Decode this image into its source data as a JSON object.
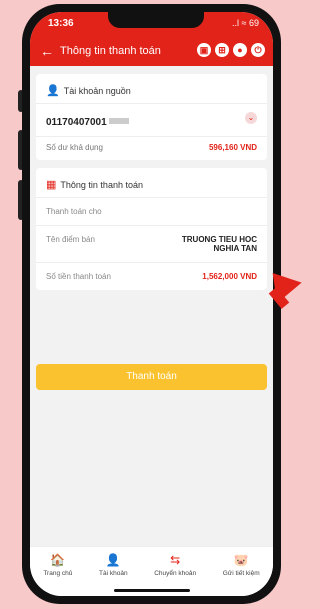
{
  "status": {
    "time": "13:36",
    "signal": "..l ≈ 69"
  },
  "header": {
    "back_icon": "←",
    "title": "Thông tin thanh toán",
    "icons": [
      "qr-icon",
      "grid-icon",
      "account-icon",
      "power-icon"
    ]
  },
  "source": {
    "section_title": "Tài khoản nguồn",
    "account_number": "01170407001",
    "balance_label": "Số dư khả dụng",
    "balance_value": "596,160 VND"
  },
  "payment": {
    "section_title": "Thông tin thanh toán",
    "pay_for_label": "Thanh toán cho",
    "merchant_label": "Tên điểm bán",
    "merchant_value": "TRUONG TIEU HOC\nNGHIA TAN",
    "amount_label": "Số tiền thanh toán",
    "amount_value": "1,562,000 VND"
  },
  "pay_button": "Thanh toán",
  "tabs": [
    {
      "label": "Trang chủ",
      "icon": "🏠"
    },
    {
      "label": "Tài khoản",
      "icon": "👤"
    },
    {
      "label": "Chuyển khoản",
      "icon": "⇆"
    },
    {
      "label": "Gửi tiết kiệm",
      "icon": "🐷"
    }
  ],
  "colors": {
    "brand": "#e2231a",
    "button": "#f9c22e"
  }
}
